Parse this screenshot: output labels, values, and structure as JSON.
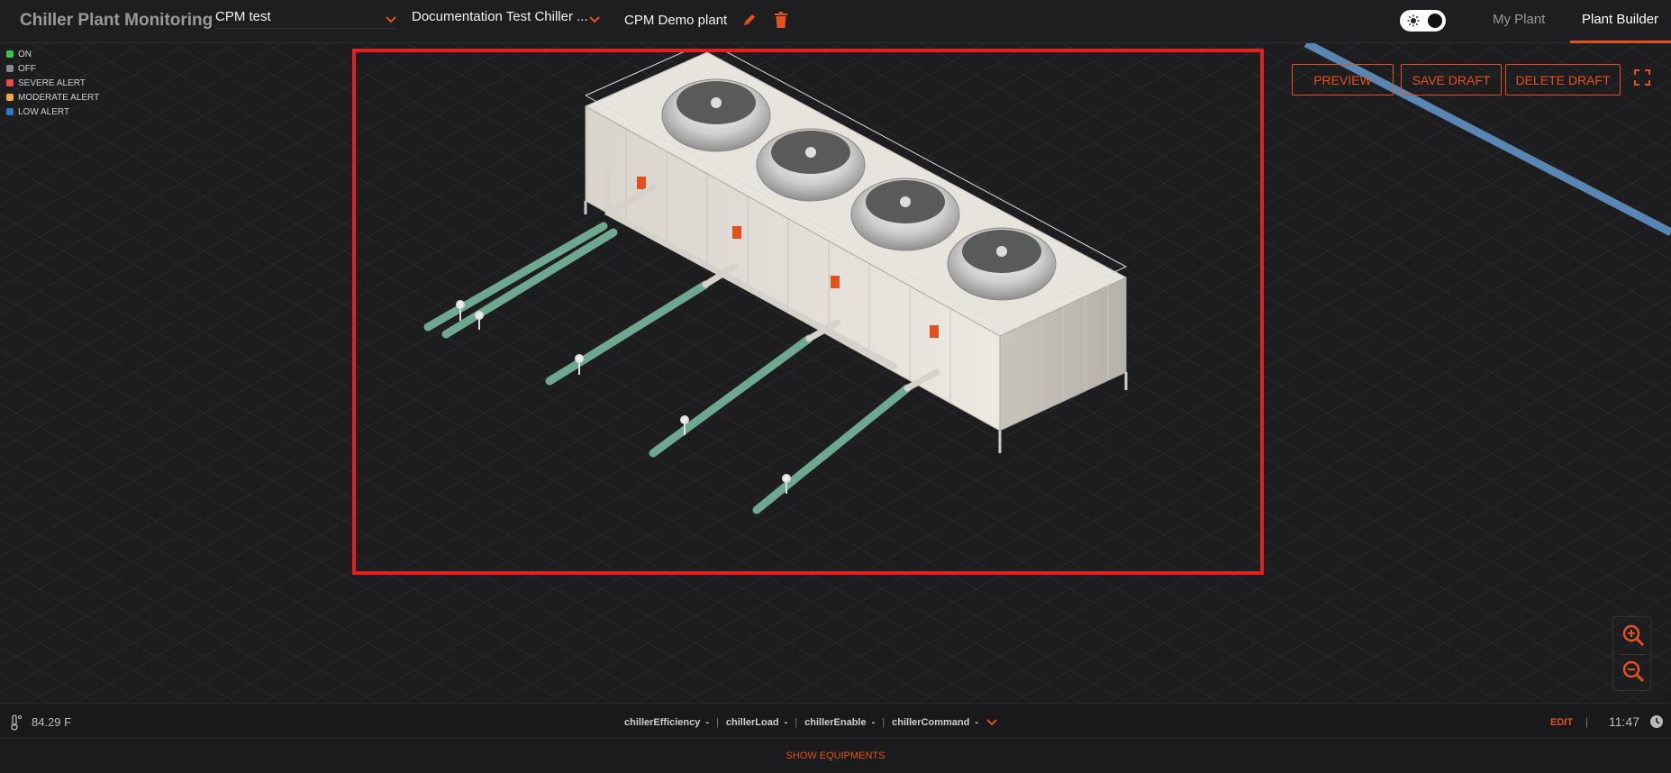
{
  "app": {
    "title": "Chiller Plant Monitoring"
  },
  "header": {
    "site_select": {
      "value": "CPM test"
    },
    "chiller_select": {
      "value": "Documentation Test Chiller ..."
    },
    "plant_name": "CPM Demo plant",
    "tabs": [
      {
        "label": "My Plant",
        "active": false
      },
      {
        "label": "Plant Builder",
        "active": true
      }
    ],
    "theme_toggle": {
      "mode": "dark"
    }
  },
  "legend": {
    "items": [
      {
        "label": "ON",
        "color": "#3cc24a"
      },
      {
        "label": "OFF",
        "color": "#8a8a8a"
      },
      {
        "label": "SEVERE ALERT",
        "color": "#e74c4c"
      },
      {
        "label": "MODERATE ALERT",
        "color": "#f3a93b"
      },
      {
        "label": "LOW ALERT",
        "color": "#2f78c4"
      }
    ]
  },
  "toolbar": {
    "preview_label": "PREVIEW",
    "save_draft_label": "SAVE DRAFT",
    "delete_draft_label": "DELETE DRAFT"
  },
  "status": {
    "temperature": "84.29 F",
    "params": [
      {
        "name": "chillerEfficiency",
        "value": "-"
      },
      {
        "name": "chillerLoad",
        "value": "-"
      },
      {
        "name": "chillerEnable",
        "value": "-"
      },
      {
        "name": "chillerCommand",
        "value": "-"
      }
    ],
    "edit_label": "EDIT",
    "time": "11:47"
  },
  "footer": {
    "show_equipments_label": "SHOW EQUIPMENTS"
  },
  "colors": {
    "accent": "#e2521f",
    "selection": "#e1201f",
    "pipe_green": "#6ea890",
    "pipe_blue": "#5a86b3"
  }
}
